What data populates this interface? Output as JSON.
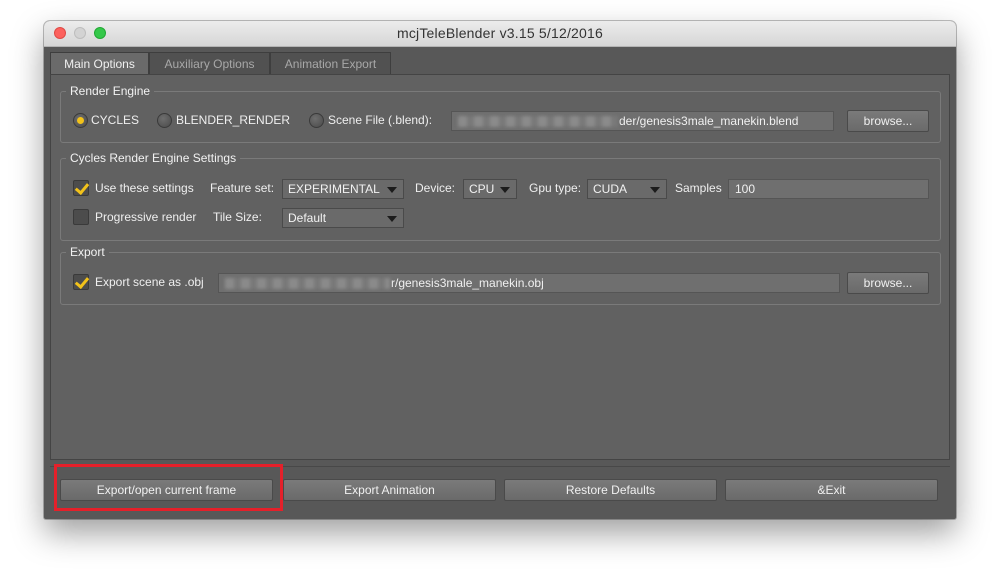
{
  "window": {
    "title": "mcjTeleBlender v3.15 5/12/2016"
  },
  "tabs": [
    "Main Options",
    "Auxiliary Options",
    "Animation Export"
  ],
  "render_engine": {
    "title": "Render Engine",
    "options": [
      "CYCLES",
      "BLENDER_RENDER",
      "Scene File (.blend):"
    ],
    "selected": "CYCLES",
    "scene_file_path": "der/genesis3male_manekin.blend",
    "browse_label": "browse..."
  },
  "cycles_settings": {
    "title": "Cycles Render Engine Settings",
    "use_these_settings_label": "Use these settings",
    "use_these_settings_checked": true,
    "feature_set_label": "Feature set:",
    "feature_set_value": "EXPERIMENTAL",
    "device_label": "Device:",
    "device_value": "CPU",
    "gpu_type_label": "Gpu type:",
    "gpu_type_value": "CUDA",
    "samples_label": "Samples",
    "samples_value": "100",
    "progressive_render_label": "Progressive render",
    "progressive_render_checked": false,
    "tile_size_label": "Tile Size:",
    "tile_size_value": "Default"
  },
  "export": {
    "title": "Export",
    "export_obj_label": "Export scene as .obj",
    "export_obj_checked": true,
    "obj_path": "r/genesis3male_manekin.obj",
    "browse_label": "browse..."
  },
  "footer_buttons": [
    "Export/open current frame",
    "Export Animation",
    "Restore Defaults",
    "&Exit"
  ],
  "colors": {
    "accent": "#f2c21a",
    "highlight": "#e5202a"
  }
}
